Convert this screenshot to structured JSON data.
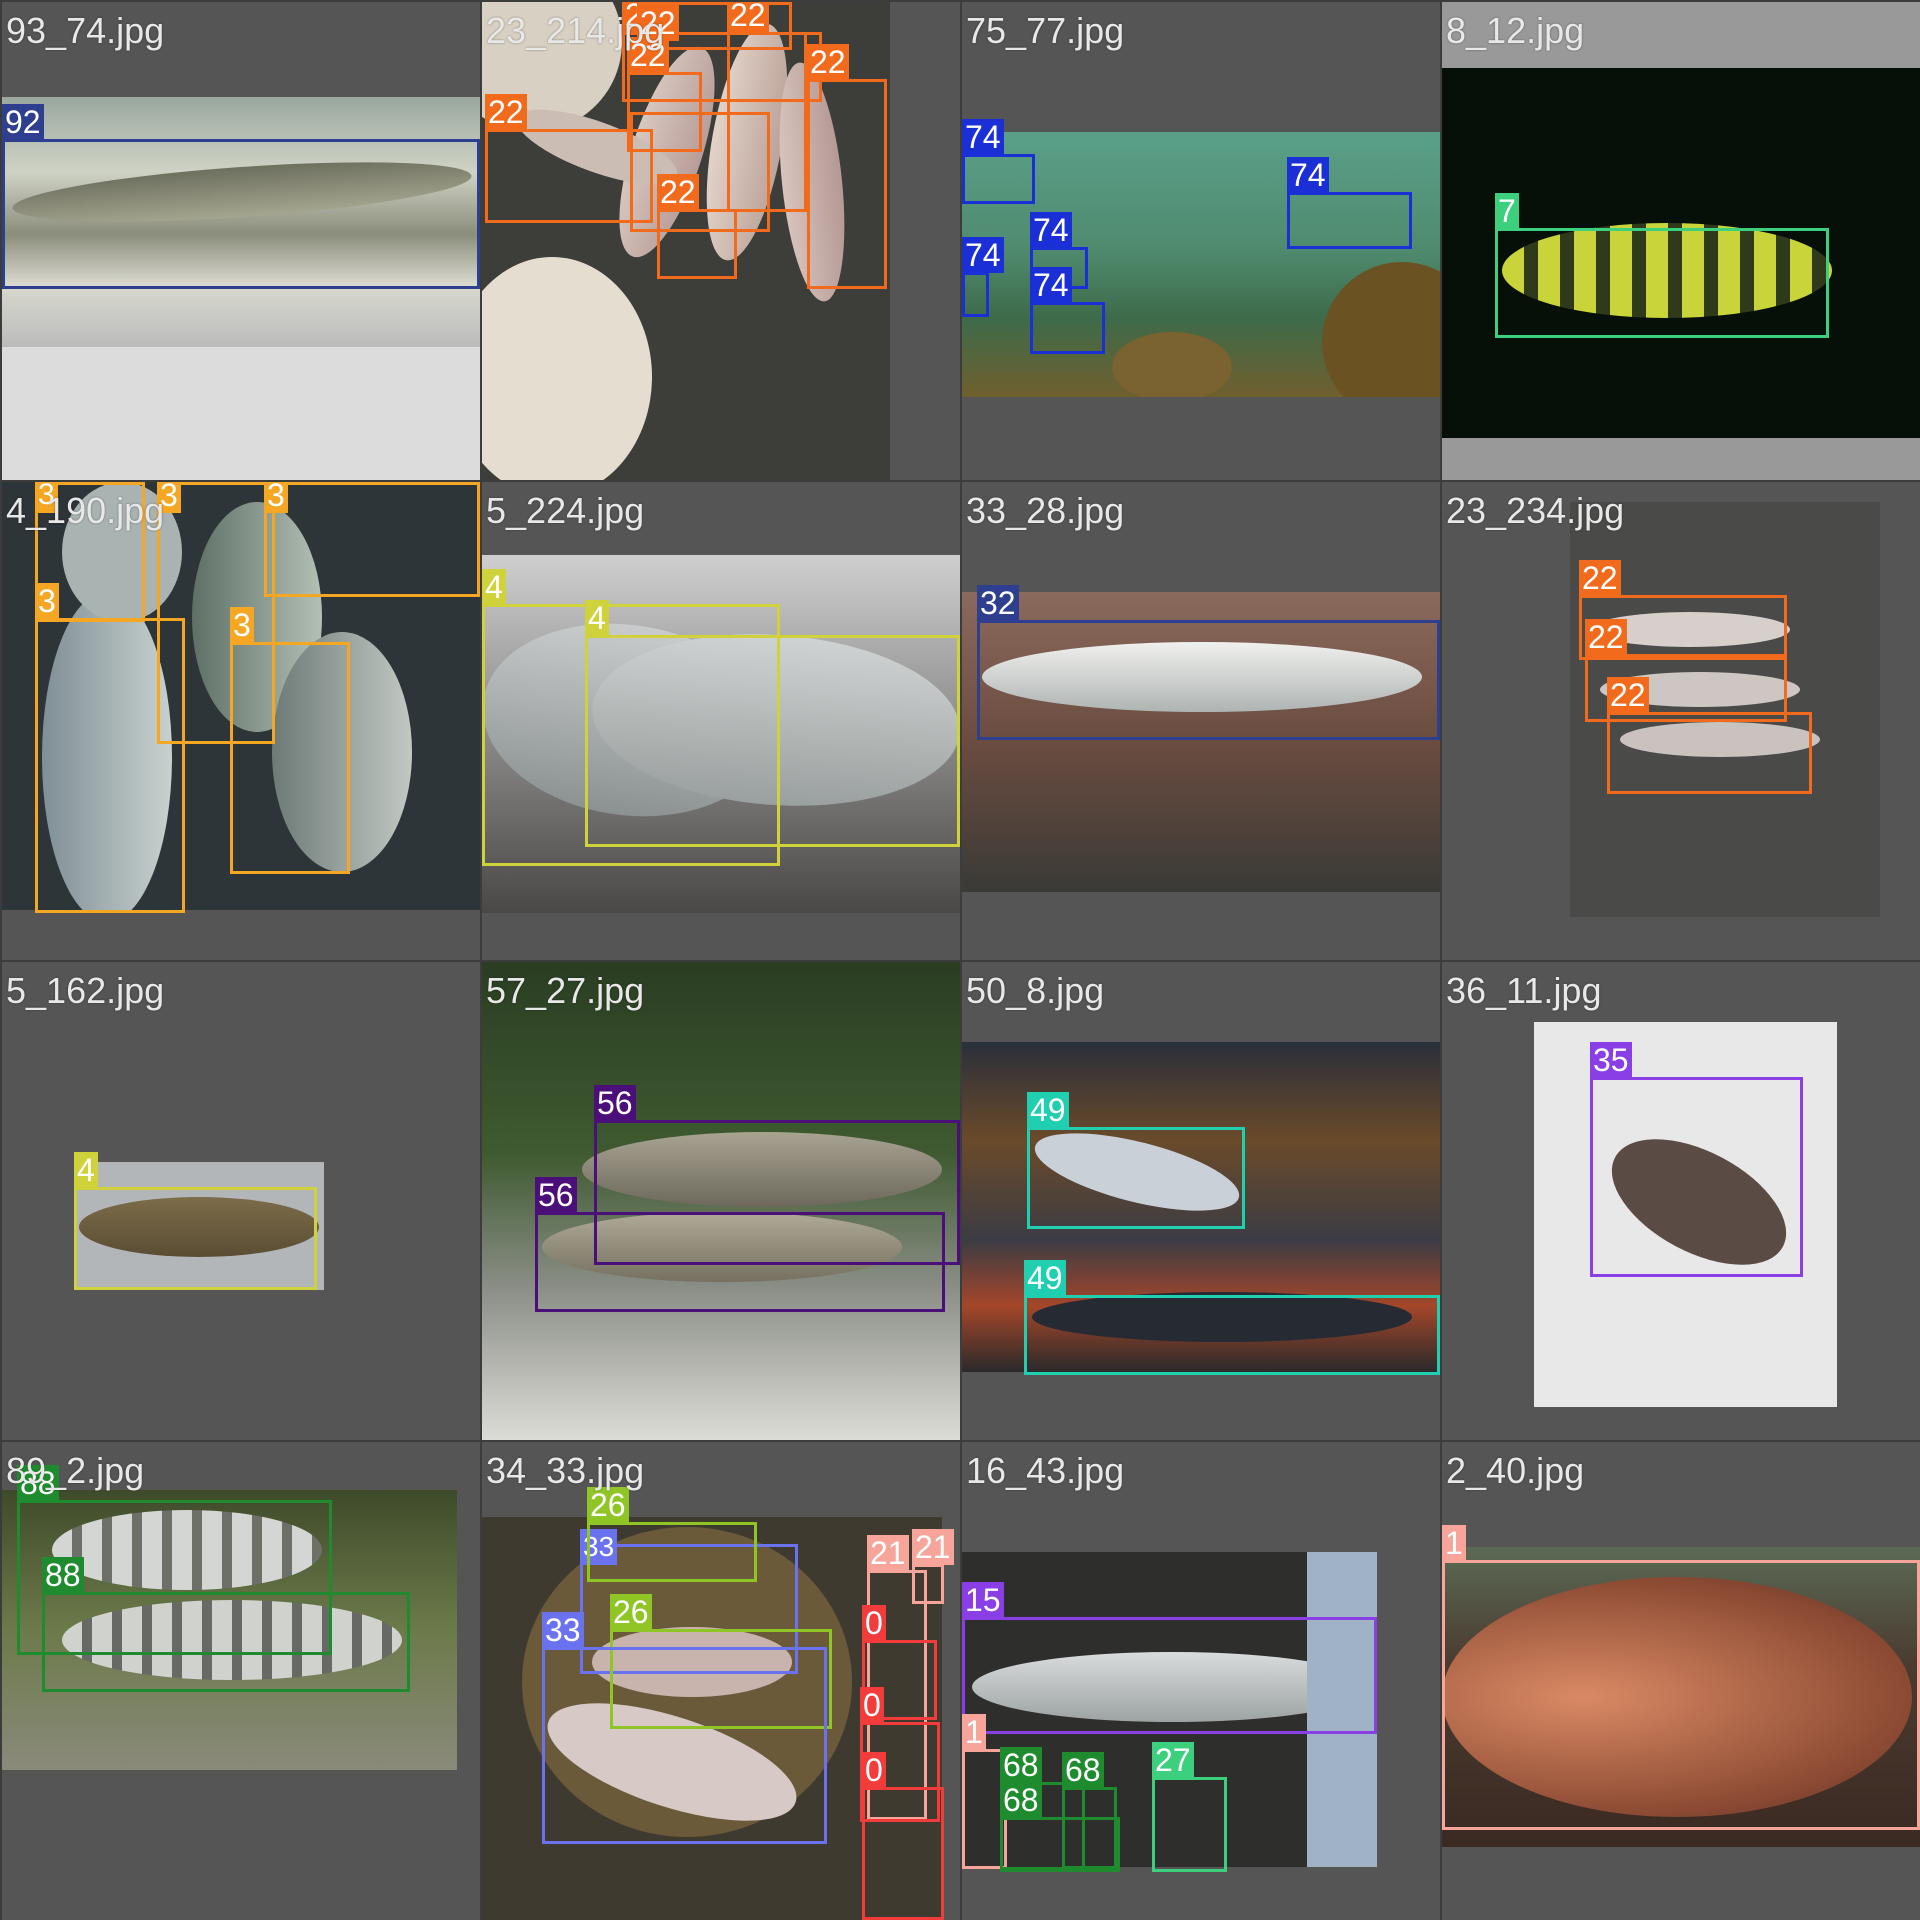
{
  "grid": {
    "tiles": [
      {
        "filename": "93_74.jpg",
        "boxes": [
          {
            "label": "92",
            "color": "#2e3f8f"
          }
        ]
      },
      {
        "filename": "23_214.jpg",
        "boxes": [
          {
            "label": "22",
            "color": "#f26b1d"
          },
          {
            "label": "22",
            "color": "#f26b1d"
          },
          {
            "label": "22",
            "color": "#f26b1d"
          },
          {
            "label": "22",
            "color": "#f26b1d"
          },
          {
            "label": "22",
            "color": "#f26b1d"
          },
          {
            "label": "22",
            "color": "#f26b1d"
          },
          {
            "label": "22",
            "color": "#f26b1d"
          },
          {
            "label": "22",
            "color": "#f26b1d"
          }
        ]
      },
      {
        "filename": "75_77.jpg",
        "boxes": [
          {
            "label": "74",
            "color": "#1a2fd6"
          },
          {
            "label": "74",
            "color": "#1a2fd6"
          },
          {
            "label": "74",
            "color": "#1a2fd6"
          },
          {
            "label": "74",
            "color": "#1a2fd6"
          },
          {
            "label": "74",
            "color": "#1a2fd6"
          }
        ]
      },
      {
        "filename": "8_12.jpg",
        "boxes": [
          {
            "label": "7",
            "color": "#3ccf7e"
          }
        ]
      },
      {
        "filename": "4_190.jpg",
        "boxes": [
          {
            "label": "3",
            "color": "#f5a623"
          },
          {
            "label": "3",
            "color": "#f5a623"
          },
          {
            "label": "3",
            "color": "#f5a623"
          },
          {
            "label": "3",
            "color": "#f5a623"
          },
          {
            "label": "3",
            "color": "#f5a623"
          }
        ]
      },
      {
        "filename": "5_224.jpg",
        "boxes": [
          {
            "label": "4",
            "color": "#cfd23a"
          },
          {
            "label": "4",
            "color": "#cfd23a"
          }
        ]
      },
      {
        "filename": "33_28.jpg",
        "boxes": [
          {
            "label": "32",
            "color": "#2e3f8f"
          }
        ]
      },
      {
        "filename": "23_234.jpg",
        "boxes": [
          {
            "label": "22",
            "color": "#f26b1d"
          },
          {
            "label": "22",
            "color": "#f26b1d"
          },
          {
            "label": "22",
            "color": "#f26b1d"
          }
        ]
      },
      {
        "filename": "5_162.jpg",
        "boxes": [
          {
            "label": "4",
            "color": "#cfd23a"
          }
        ]
      },
      {
        "filename": "57_27.jpg",
        "boxes": [
          {
            "label": "56",
            "color": "#4b0f7a"
          },
          {
            "label": "56",
            "color": "#4b0f7a"
          }
        ]
      },
      {
        "filename": "50_8.jpg",
        "boxes": [
          {
            "label": "49",
            "color": "#1fcfb0"
          },
          {
            "label": "49",
            "color": "#1fcfb0"
          }
        ]
      },
      {
        "filename": "36_11.jpg",
        "boxes": [
          {
            "label": "35",
            "color": "#8a3ee6"
          }
        ]
      },
      {
        "filename": "89_2.jpg",
        "boxes": [
          {
            "label": "88",
            "color": "#1e8c2e"
          },
          {
            "label": "88",
            "color": "#1e8c2e"
          }
        ]
      },
      {
        "filename": "34_33.jpg",
        "boxes": [
          {
            "label": "33",
            "color": "#6a72f0"
          },
          {
            "label": "26",
            "color": "#8fc625"
          },
          {
            "label": "26",
            "color": "#8fc625"
          },
          {
            "label": "33",
            "color": "#6a72f0"
          },
          {
            "label": "21",
            "color": "#f7a49a"
          },
          {
            "label": "21",
            "color": "#f7a49a"
          },
          {
            "label": "0",
            "color": "#f23b3b"
          },
          {
            "label": "0",
            "color": "#f23b3b"
          },
          {
            "label": "0",
            "color": "#f23b3b"
          }
        ]
      },
      {
        "filename": "16_43.jpg",
        "boxes": [
          {
            "label": "15",
            "color": "#8a3ee6"
          },
          {
            "label": "1",
            "color": "#f7a49a"
          },
          {
            "label": "68",
            "color": "#1e8c2e"
          },
          {
            "label": "68",
            "color": "#1e8c2e"
          },
          {
            "label": "68",
            "color": "#1e8c2e"
          },
          {
            "label": "27",
            "color": "#3ccf7e"
          }
        ]
      },
      {
        "filename": "2_40.jpg",
        "boxes": [
          {
            "label": "1",
            "color": "#f7a49a"
          }
        ]
      }
    ]
  }
}
